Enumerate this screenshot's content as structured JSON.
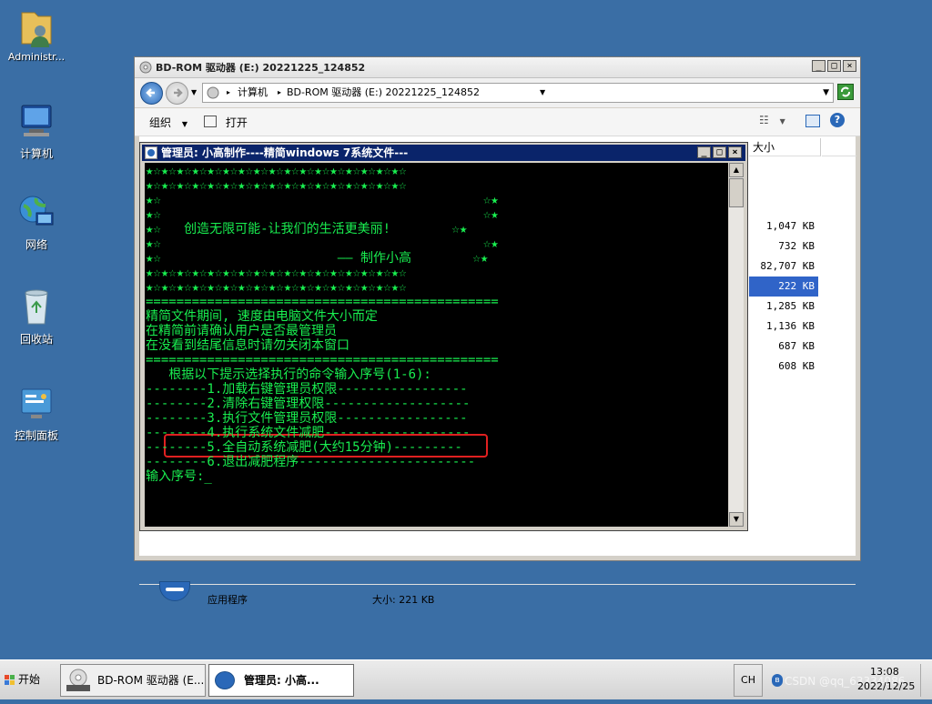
{
  "desktop": {
    "icons": [
      {
        "label": "Administr..."
      },
      {
        "label": "计算机"
      },
      {
        "label": "网络"
      },
      {
        "label": "回收站"
      },
      {
        "label": "控制面板"
      }
    ]
  },
  "explorer": {
    "title": "BD-ROM 驱动器 (E:) 20221225_124852",
    "address": {
      "crumbs": [
        "计算机",
        "BD-ROM 驱动器 (E:) 20221225_124852"
      ]
    },
    "toolbar": {
      "organize": "组织",
      "open": "打开"
    },
    "column_size": "大小",
    "sizes": [
      "1,047 KB",
      "732 KB",
      "82,707 KB",
      "222 KB",
      "1,285 KB",
      "1,136 KB",
      "687 KB",
      "608 KB"
    ],
    "selected_index": 3,
    "details": {
      "type": "应用程序",
      "size": "大小: 221 KB"
    }
  },
  "console": {
    "title": "管理员:  小高制作----精简windows 7系统文件---",
    "lines": [
      "★☆★☆★☆★☆★☆★☆★☆★☆★☆★☆★☆★☆★☆★☆★☆★☆★☆",
      "★☆★☆★☆★☆★☆★☆★☆★☆★☆★☆★☆★☆★☆★☆★☆★☆★☆",
      "★☆                                          ☆★",
      "★☆                                          ☆★",
      "★☆   创造无限可能-让我们的生活更美丽!        ☆★",
      "★☆                                          ☆★",
      "★☆                       —— 制作小高        ☆★",
      "★☆★☆★☆★☆★☆★☆★☆★☆★☆★☆★☆★☆★☆★☆★☆★☆★☆",
      "★☆★☆★☆★☆★☆★☆★☆★☆★☆★☆★☆★☆★☆★☆★☆★☆★☆",
      "==============================================",
      "精简文件期间, 速度由电脑文件大小而定",
      "在精简前请确认用户是否最管理员",
      "在没看到结尾信息时请勿关闭本窗口",
      "==============================================",
      "   根据以下提示选择执行的命令输入序号(1-6):",
      "--------1.加载右键管理员权限-----------------",
      "--------2.清除右键管理权限-------------------",
      "--------3.执行文件管理员权限-----------------",
      "--------4.执行系统文件减肥-------------------",
      "--------5.全自动系统减肥(大约15分钟)---------",
      "--------6.退出减肥程序-----------------------",
      "输入序号:_"
    ]
  },
  "taskbar": {
    "start": "开始",
    "items": [
      {
        "label": "BD-ROM 驱动器 (E..."
      },
      {
        "label": "管理员:  小高..."
      }
    ],
    "lang": "CH",
    "time": "13:08",
    "date": "2022/12/25",
    "watermark": "CSDN @qq_63334086"
  },
  "colors": {
    "desktop": "#3a6ea5",
    "console_text": "#19ef50",
    "highlight": "#e02020",
    "selection": "#3064c8"
  }
}
